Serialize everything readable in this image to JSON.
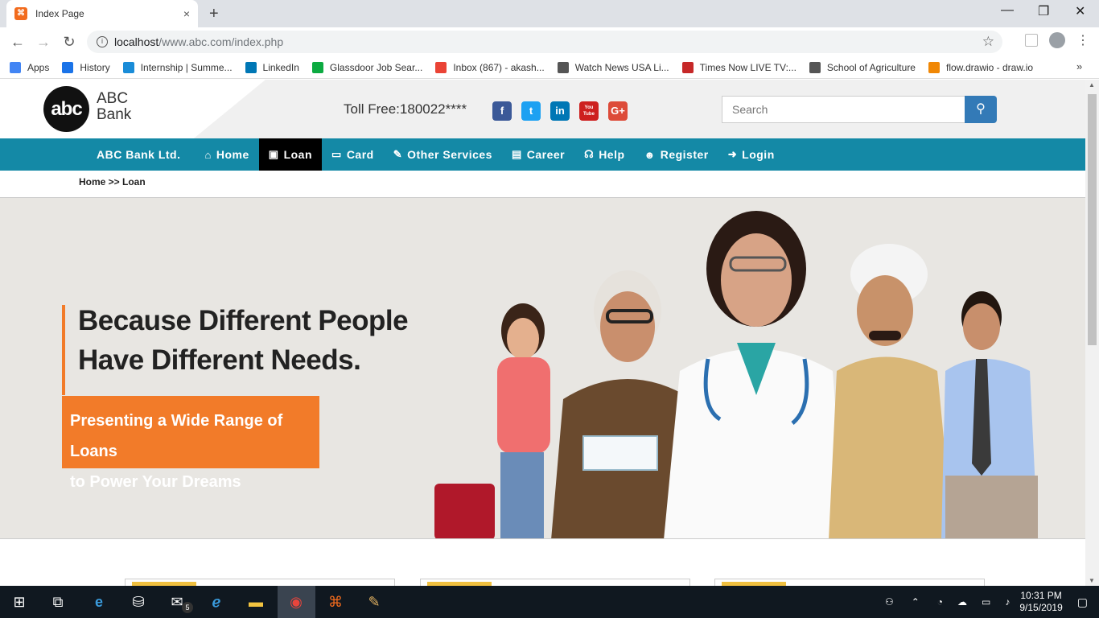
{
  "browser": {
    "tab_title": "Index Page",
    "tab_close": "×",
    "new_tab": "+",
    "url_host": "localhost",
    "url_path": "/www.abc.com/index.php",
    "bookmarks": [
      {
        "label": "Apps",
        "icon": "apps-grid-icon",
        "color": "#4285f4"
      },
      {
        "label": "History",
        "icon": "history-icon",
        "color": "#1a73e8"
      },
      {
        "label": "Internship | Summe...",
        "icon": "internshala-icon",
        "color": "#1a8cd8"
      },
      {
        "label": "LinkedIn",
        "icon": "linkedin-icon",
        "color": "#0077b5"
      },
      {
        "label": "Glassdoor Job Sear...",
        "icon": "glassdoor-icon",
        "color": "#0caa41"
      },
      {
        "label": "Inbox (867) - akash...",
        "icon": "google-icon",
        "color": "#ea4335"
      },
      {
        "label": "Watch News USA Li...",
        "icon": "globe-icon",
        "color": "#555555"
      },
      {
        "label": "Times Now LIVE TV:...",
        "icon": "times-now-icon",
        "color": "#c62828"
      },
      {
        "label": "School of Agriculture",
        "icon": "globe-icon",
        "color": "#555555"
      },
      {
        "label": "flow.drawio - draw.io",
        "icon": "drawio-icon",
        "color": "#f08705"
      }
    ]
  },
  "site": {
    "logo_mark": "abc",
    "logo_line1": "ABC",
    "logo_line2": "Bank",
    "tollfree": "Toll Free:180022****",
    "search_placeholder": "Search",
    "social": [
      {
        "name": "facebook-icon",
        "glyph": "f",
        "color": "#3b5998"
      },
      {
        "name": "twitter-icon",
        "glyph": "t",
        "color": "#1da1f2"
      },
      {
        "name": "linkedin-icon",
        "glyph": "in",
        "color": "#0077b5"
      },
      {
        "name": "youtube-icon",
        "glyph": "You Tube",
        "color": "#cd201f"
      },
      {
        "name": "googleplus-icon",
        "glyph": "G+",
        "color": "#dd4b39"
      }
    ],
    "nav": [
      {
        "label": "ABC Bank Ltd.",
        "icon": "",
        "name": "nav-brand"
      },
      {
        "label": "Home",
        "icon": "⌂",
        "name": "nav-home"
      },
      {
        "label": "Loan",
        "icon": "▣",
        "name": "nav-loan",
        "active": true
      },
      {
        "label": "Card",
        "icon": "▭",
        "name": "nav-card"
      },
      {
        "label": "Other Services",
        "icon": "✎",
        "name": "nav-other-services"
      },
      {
        "label": "Career",
        "icon": "▤",
        "name": "nav-career"
      },
      {
        "label": "Help",
        "icon": "☊",
        "name": "nav-help"
      },
      {
        "label": "Register",
        "icon": "☻",
        "name": "nav-register"
      },
      {
        "label": "Login",
        "icon": "➜",
        "name": "nav-login"
      }
    ],
    "breadcrumb": "Home >> Loan",
    "hero": {
      "line1": "Because Different People",
      "line2": "Have Different Needs.",
      "sub1": "Presenting a Wide Range of Loans",
      "sub2": "to Power Your Dreams"
    }
  },
  "taskbar": {
    "time": "10:31 PM",
    "date": "9/15/2019",
    "mail_badge": "5"
  }
}
